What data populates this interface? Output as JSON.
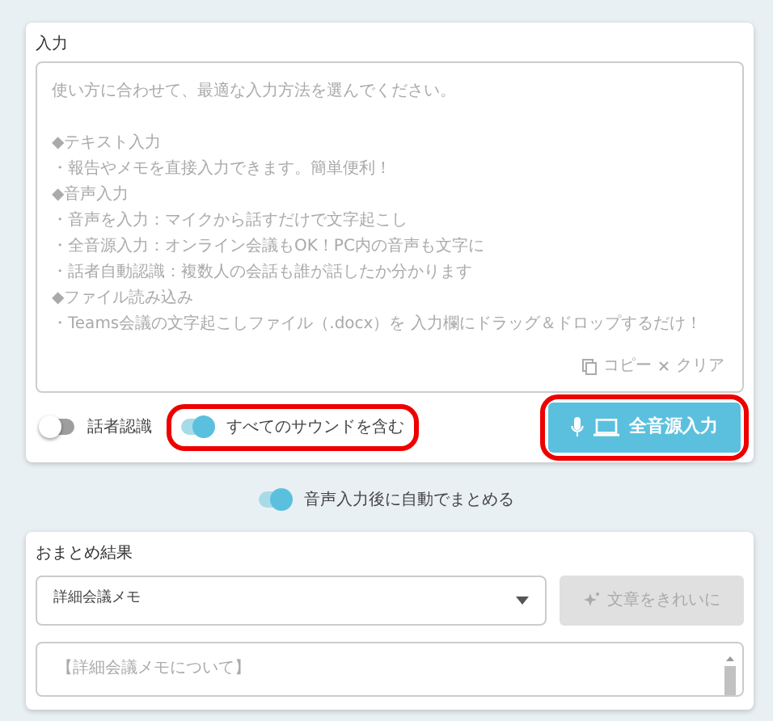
{
  "input_panel": {
    "title": "入力",
    "textarea": {
      "intro": "使い方に合わせて、最適な入力方法を選んでください。",
      "hint_lines": [
        "◆テキスト入力",
        "・報告やメモを直接入力できます。簡単便利！",
        "◆音声入力",
        "・音声を入力：マイクから話すだけで文字起こし",
        "・全音源入力：オンライン会議もOK！PC内の音声も文字に",
        "・話者自動認識：複数人の会話も誰が話したか分かります",
        "◆ファイル読み込み",
        "・Teams会議の文字起こしファイル（.docx）を 入力欄にドラッグ＆ドロップするだけ！"
      ]
    },
    "copy_label": "コピー",
    "clear_label": "クリア",
    "toggles": [
      {
        "label": "話者認識",
        "on": false,
        "highlighted": false
      },
      {
        "label": "すべてのサウンドを含む",
        "on": true,
        "highlighted": true
      }
    ],
    "record_button": {
      "label": "全音源入力",
      "highlighted": true
    }
  },
  "auto_summary_toggle": {
    "label": "音声入力後に自動でまとめる",
    "on": true
  },
  "summary_panel": {
    "title": "おまとめ結果",
    "template_select": {
      "value": "詳細会議メモ"
    },
    "clean_button": {
      "label": "文章をきれいに",
      "disabled": true
    },
    "result_first_line": "【詳細会議メモについて】"
  }
}
